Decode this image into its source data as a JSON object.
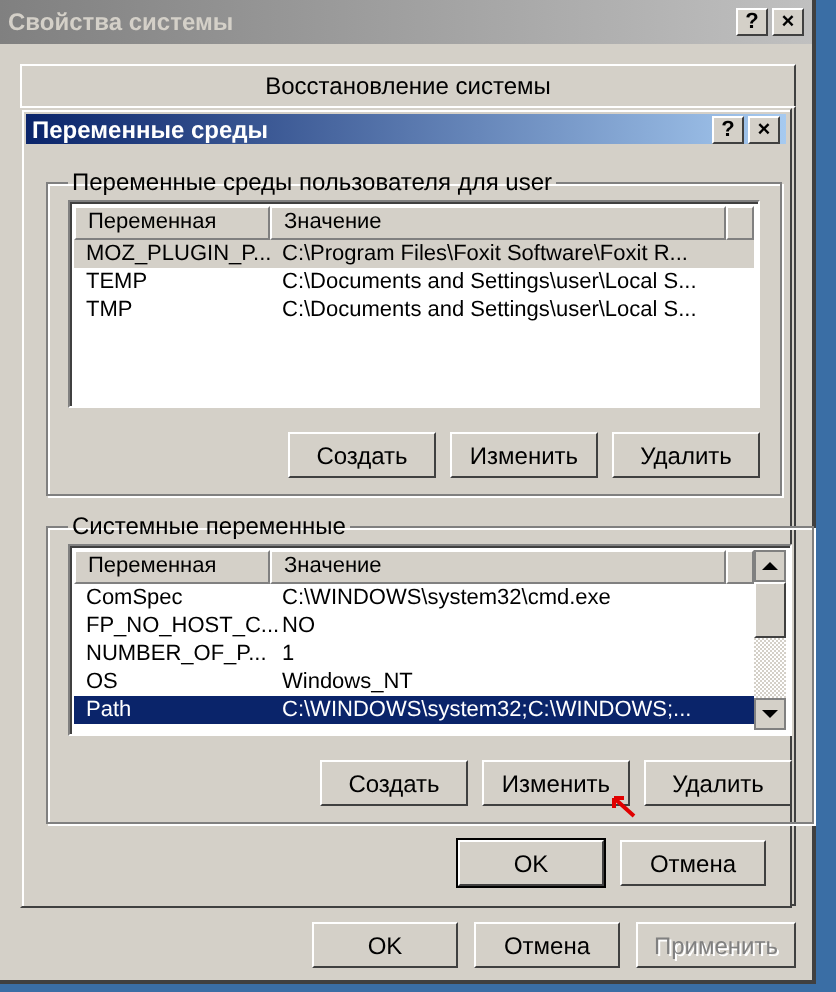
{
  "window": {
    "title": "Свойства системы",
    "title_buttons": [
      "?",
      "×"
    ]
  },
  "tab": {
    "label": "Восстановление системы"
  },
  "dialog": {
    "title": "Переменные среды",
    "title_buttons": [
      "?",
      "×"
    ],
    "user_group": {
      "title": "Переменные среды пользователя для user",
      "focused": false,
      "columns": [
        "Переменная",
        "Значение"
      ],
      "rows": [
        {
          "name": "MOZ_PLUGIN_P...",
          "value": "C:\\Program Files\\Foxit Software\\Foxit R...",
          "selected": true
        },
        {
          "name": "TEMP",
          "value": "C:\\Documents and Settings\\user\\Local S...",
          "selected": false
        },
        {
          "name": "TMP",
          "value": "C:\\Documents and Settings\\user\\Local S...",
          "selected": false
        }
      ],
      "buttons": [
        "Создать",
        "Изменить",
        "Удалить"
      ]
    },
    "system_group": {
      "title": "Системные переменные",
      "focused": true,
      "columns": [
        "Переменная",
        "Значение"
      ],
      "rows": [
        {
          "name": "ComSpec",
          "value": "C:\\WINDOWS\\system32\\cmd.exe",
          "selected": false
        },
        {
          "name": "FP_NO_HOST_C...",
          "value": "NO",
          "selected": false
        },
        {
          "name": "NUMBER_OF_P...",
          "value": "1",
          "selected": false
        },
        {
          "name": "OS",
          "value": "Windows_NT",
          "selected": false
        },
        {
          "name": "Path",
          "value": "C:\\WINDOWS\\system32;C:\\WINDOWS;...",
          "selected": true
        }
      ],
      "buttons": [
        "Создать",
        "Изменить",
        "Удалить"
      ]
    },
    "buttons": [
      {
        "label": "OK",
        "default": true
      },
      {
        "label": "Отмена",
        "default": false
      }
    ]
  },
  "window_buttons": [
    {
      "label": "OK",
      "disabled": false
    },
    {
      "label": "Отмена",
      "disabled": false
    },
    {
      "label": "Применить",
      "disabled": true
    }
  ]
}
